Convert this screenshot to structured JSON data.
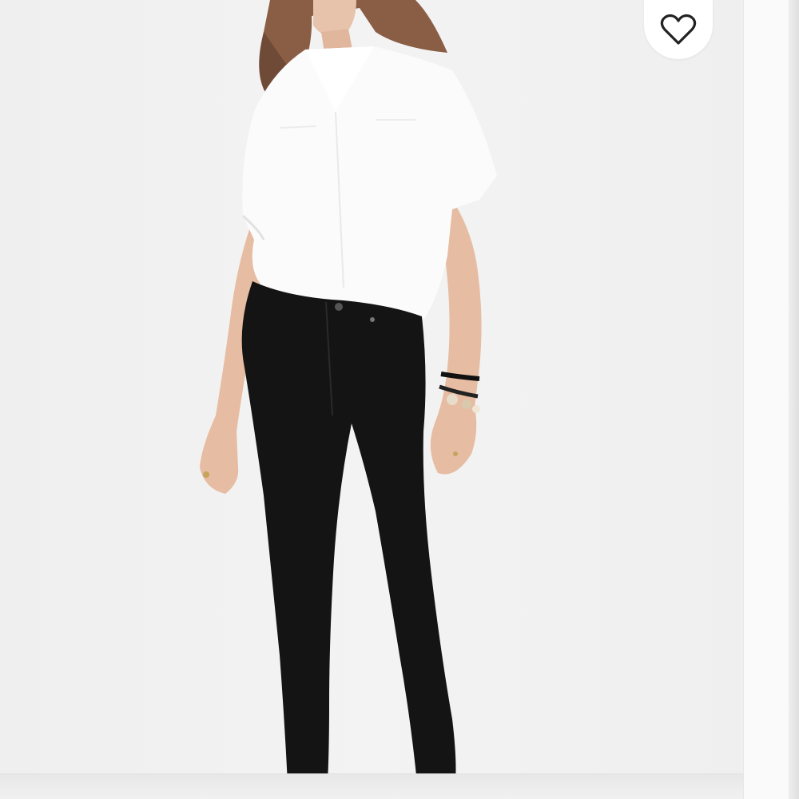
{
  "product_image": {
    "icon": "product-photo",
    "description_tag": "model-wearing-white-shirt-and-black-jeans"
  },
  "favorite": {
    "icon": "heart-icon",
    "color": "#222222",
    "background": "#ffffff"
  },
  "colors": {
    "backdrop": "#efefef",
    "jeans": "#141414",
    "shirt": "#fbfbfb"
  }
}
